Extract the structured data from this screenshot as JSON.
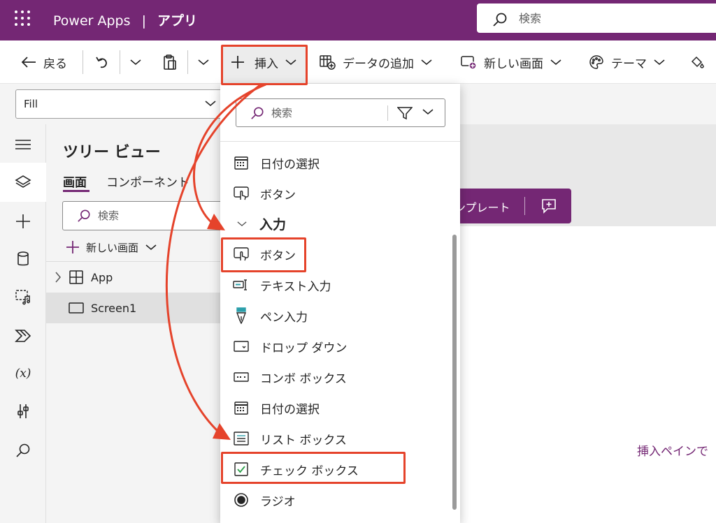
{
  "titlebar": {
    "product": "Power Apps",
    "separator": "|",
    "app_label": "アプリ",
    "search_placeholder": "検索"
  },
  "toolbar": {
    "back": "戻る",
    "insert": "挿入",
    "add_data": "データの追加",
    "new_screen": "新しい画面",
    "theme": "テーマ"
  },
  "formula_bar": {
    "property": "Fill"
  },
  "tree_view": {
    "title": "ツリー ビュー",
    "tab_screens": "画面",
    "tab_components": "コンポーネント",
    "search_placeholder": "検索",
    "new_screen": "新しい画面",
    "items": [
      {
        "label": "App"
      },
      {
        "label": "Screen1"
      }
    ]
  },
  "canvas": {
    "template_button": "ンプレート",
    "hint": "挿入ペインで"
  },
  "insert_menu": {
    "search_placeholder": "検索",
    "items_top": [
      {
        "label": "日付の選択",
        "icon": "calendar-icon"
      },
      {
        "label": "ボタン",
        "icon": "button-icon"
      }
    ],
    "section": "入力",
    "items_input": [
      {
        "label": "ボタン",
        "icon": "button-icon"
      },
      {
        "label": "テキスト入力",
        "icon": "text-input-icon"
      },
      {
        "label": "ペン入力",
        "icon": "pen-icon"
      },
      {
        "label": "ドロップ ダウン",
        "icon": "dropdown-icon"
      },
      {
        "label": "コンボ ボックス",
        "icon": "combobox-icon"
      },
      {
        "label": "日付の選択",
        "icon": "calendar-icon"
      },
      {
        "label": "リスト ボックス",
        "icon": "listbox-icon"
      },
      {
        "label": "チェック ボックス",
        "icon": "checkbox-icon"
      },
      {
        "label": "ラジオ",
        "icon": "radio-icon"
      }
    ]
  },
  "colors": {
    "brand": "#742774",
    "annotation": "#e5432b"
  }
}
